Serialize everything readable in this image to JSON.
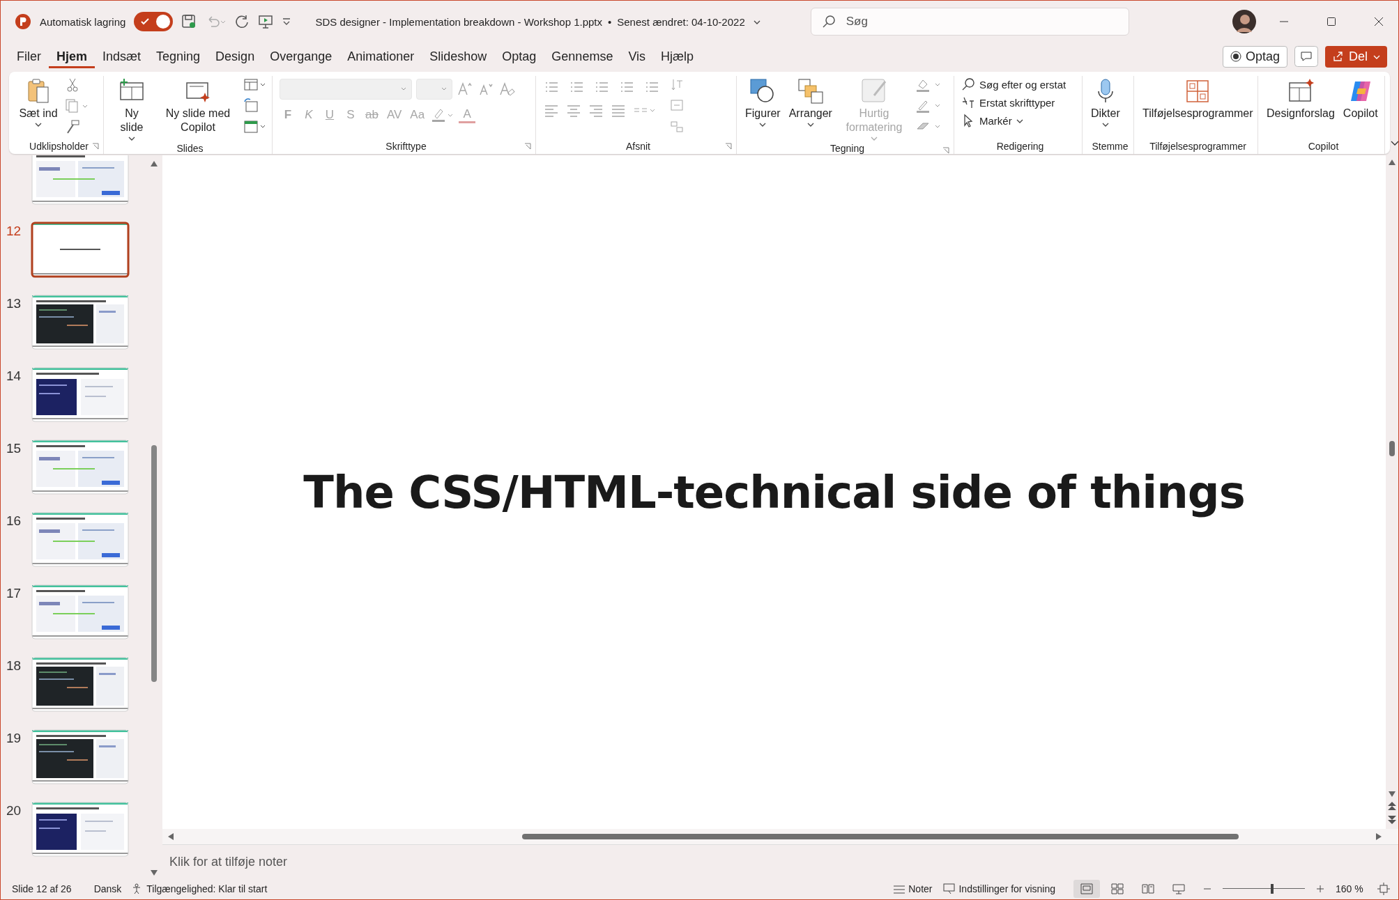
{
  "title_bar": {
    "autosave_label": "Automatisk lagring",
    "autosave_on": true,
    "document_title": "SDS designer - Implementation breakdown - Workshop 1.pptx",
    "separator": "•",
    "saved_info": "Senest ændret: 04-10-2022",
    "search": {
      "placeholder": "Søg"
    }
  },
  "tabs": [
    {
      "label": "Filer",
      "selected": false
    },
    {
      "label": "Hjem",
      "selected": true
    },
    {
      "label": "Indsæt",
      "selected": false
    },
    {
      "label": "Tegning",
      "selected": false
    },
    {
      "label": "Design",
      "selected": false
    },
    {
      "label": "Overgange",
      "selected": false
    },
    {
      "label": "Animationer",
      "selected": false
    },
    {
      "label": "Slideshow",
      "selected": false
    },
    {
      "label": "Optag",
      "selected": false
    },
    {
      "label": "Gennemse",
      "selected": false
    },
    {
      "label": "Vis",
      "selected": false
    },
    {
      "label": "Hjælp",
      "selected": false
    }
  ],
  "actions": {
    "record": "Optag",
    "share": "Del"
  },
  "ribbon": {
    "groups": [
      {
        "kind": "clipboard",
        "label": "Udklipsholder",
        "paste": "Sæt ind"
      },
      {
        "kind": "slides",
        "label": "Slides",
        "new_slide": "Ny slide",
        "copilot_slide": "Ny slide med Copilot"
      },
      {
        "kind": "font",
        "label": "Skrifttype",
        "disabled": true,
        "buttons": [
          "F",
          "K",
          "U",
          "S",
          "ab",
          "AV",
          "Aa"
        ],
        "font_color": "A"
      },
      {
        "kind": "paragraph",
        "label": "Afsnit",
        "disabled": true
      },
      {
        "kind": "drawing",
        "label": "Tegning",
        "shapes": "Figurer",
        "arrange": "Arranger",
        "quick_styles": {
          "label": "Hurtig formatering",
          "disabled": true
        }
      },
      {
        "kind": "editing",
        "label": "Redigering",
        "items": [
          "Søg efter og erstat",
          "Erstat skrifttyper",
          "Markér"
        ]
      },
      {
        "kind": "voice",
        "label": "Stemme",
        "dictate": "Dikter"
      },
      {
        "kind": "addins",
        "label": "Tilføjelsesprogrammer",
        "addins": "Tilføjelsesprogrammer"
      },
      {
        "kind": "copilot",
        "label": "Copilot",
        "designer": "Designforslag",
        "copilot": "Copilot"
      }
    ]
  },
  "slides": [
    {
      "kind": "light",
      "selected": false
    },
    {
      "number": "12",
      "kind": "title",
      "selected": true
    },
    {
      "number": "13",
      "kind": "dark",
      "selected": false
    },
    {
      "number": "14",
      "kind": "navy",
      "selected": false
    },
    {
      "number": "15",
      "kind": "light",
      "selected": false
    },
    {
      "number": "16",
      "kind": "light",
      "selected": false
    },
    {
      "number": "17",
      "kind": "light",
      "selected": false
    },
    {
      "number": "18",
      "kind": "dark",
      "selected": false
    },
    {
      "number": "19",
      "kind": "dark",
      "selected": false
    },
    {
      "number": "20",
      "kind": "navy",
      "selected": false
    }
  ],
  "slide": {
    "title": "The CSS/HTML-technical side of things"
  },
  "notes": {
    "placeholder": "Klik for at tilføje noter"
  },
  "status_bar": {
    "slide_info": "Slide 12 af 26",
    "language": "Dansk",
    "accessibility": "Tilgængelighed: Klar til start",
    "notes": "Noter",
    "display_settings": "Indstillinger for visning",
    "views": [
      {
        "selected": true
      },
      {
        "selected": false
      },
      {
        "selected": false
      },
      {
        "selected": false
      }
    ],
    "zoom": {
      "level": 0.6,
      "reading": "160 %"
    }
  }
}
